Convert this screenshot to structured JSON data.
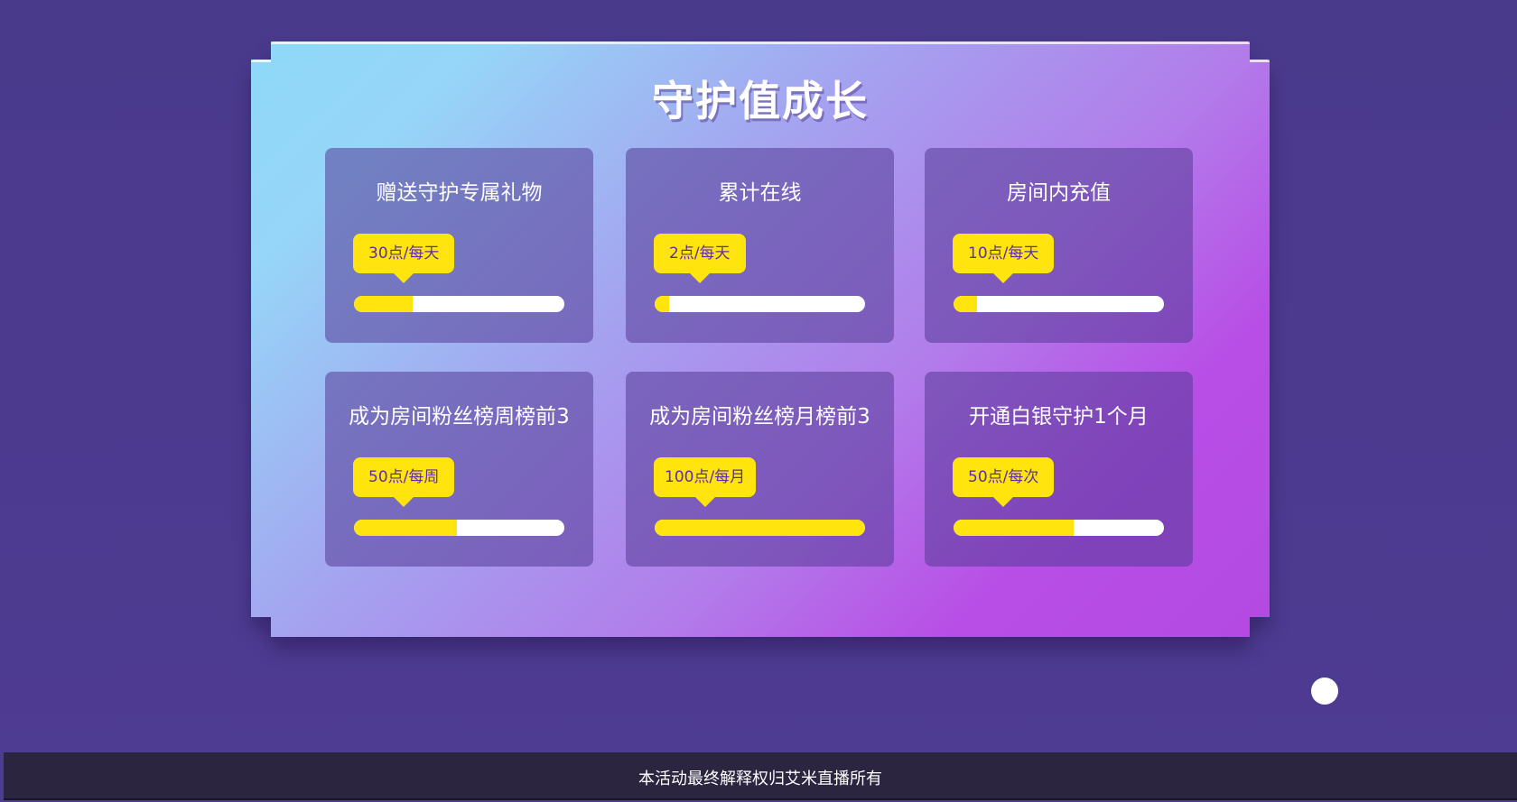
{
  "title": "守护值成长",
  "cards": [
    {
      "title": "赠送守护专属礼物",
      "badge": "30点/每天",
      "progress": 0.28
    },
    {
      "title": "累计在线",
      "badge": "2点/每天",
      "progress": 0.07
    },
    {
      "title": "房间内充值",
      "badge": "10点/每天",
      "progress": 0.11
    },
    {
      "title": "成为房间粉丝榜周榜前3",
      "badge": "50点/每周",
      "progress": 0.49
    },
    {
      "title": "成为房间粉丝榜月榜前3",
      "badge": "100点/每月",
      "progress": 1.0
    },
    {
      "title": "开通白银守护1个月",
      "badge": "50点/每次",
      "progress": 0.57
    }
  ],
  "footer": "本活动最终解释权归艾米直播所有",
  "colors": {
    "accent_yellow": "#ffe40e",
    "badge_text": "#5a2fa6",
    "page_background": "#4d3a8f",
    "footer_background": "#2b2540"
  }
}
